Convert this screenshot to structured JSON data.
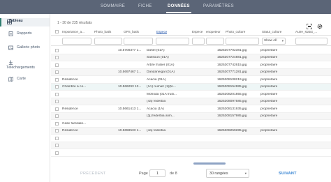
{
  "nav": {
    "tabs": [
      {
        "label": "SOMMAIRE"
      },
      {
        "label": "FICHE"
      },
      {
        "label": "DONNÉES"
      },
      {
        "label": "PARAMÈTRES"
      }
    ],
    "active_tab": "DONNÉES"
  },
  "sidebar": {
    "items": [
      {
        "label": "Tableau",
        "icon": "table-icon",
        "active": true
      },
      {
        "label": "Rapports",
        "icon": "report-icon",
        "active": false
      },
      {
        "label": "Gallerie photo",
        "icon": "photo-gallery-icon",
        "active": false
      },
      {
        "label": "Téléchargements",
        "icon": "download-icon",
        "active": false
      },
      {
        "label": "Carte",
        "icon": "map-icon",
        "active": false
      }
    ]
  },
  "table": {
    "results_text": "1 - 30 de 235 résultats",
    "columns": [
      {
        "label": "Importance_a..."
      },
      {
        "label": "Photo_batis"
      },
      {
        "label": "GPS_batis"
      },
      {
        "label": "Espece"
      },
      {
        "label": "Espece"
      },
      {
        "label": "enqueteur"
      },
      {
        "label": "Photo_culture"
      },
      {
        "label": "Statut_culture"
      },
      {
        "label": "Autre_statut_..."
      }
    ],
    "filter_select_value": "Show All",
    "rows": [
      {
        "importance": "",
        "gps": "10.5700377 1...",
        "espece": "Dahel (01A)",
        "photo": "1625307702381.jpg",
        "statut": "propriétaire"
      },
      {
        "importance": "",
        "gps": "",
        "espece": "Sassoun (01A)",
        "photo": "1625307724881.jpg",
        "statut": "propriétaire"
      },
      {
        "importance": "",
        "gps": "",
        "espece": "Arbre fruitier (01A)",
        "photo": "1625307742615.jpg",
        "statut": "propriétaire"
      },
      {
        "importance": "",
        "gps": "10.5697467 1...",
        "espece": "Dandaneigal (01A)",
        "photo": "1625307771281.jpg",
        "statut": "propriétaire"
      },
      {
        "importance": "Résidence",
        "gps": "",
        "espece": "Acacia (01A)",
        "photo": "1625308108219.jpg",
        "statut": "propriétaire"
      },
      {
        "importance": "Chambre à co...",
        "gps": "10.566293 13...",
        "espece": "(1A) numier (1)(fe...",
        "photo": "1625308154985.jpg",
        "statut": "propriétaire"
      },
      {
        "importance": "",
        "gps": "",
        "espece": "Mohoda (01A fruiti...",
        "photo": "1625308201855.jpg",
        "statut": "propriétaire"
      },
      {
        "importance": "",
        "gps": "",
        "espece": "(4a) federbia",
        "photo": "1625308097585.jpg",
        "statut": "propriétaire"
      },
      {
        "importance": "Résidence",
        "gps": "10.5661413 1...",
        "espece": "Acacia (1A)",
        "photo": "1625308131935.jpg",
        "statut": "propriétaire"
      },
      {
        "importance": "",
        "gps": "",
        "espece": "(2j) federbia alim...",
        "photo": "1625308157985.jpg",
        "statut": "propriétaire"
      },
      {
        "importance": "Case familiale...",
        "gps": "",
        "espece": "",
        "photo": "",
        "statut": ""
      },
      {
        "importance": "Résidence",
        "gps": "10.5659533 1...",
        "espece": "(4a) federbia",
        "photo": "1625308259285.jpg",
        "statut": "propriétaire"
      }
    ]
  },
  "pager": {
    "prev_label": "PRÉCÉDENT",
    "page_label": "Page",
    "page_value": "1",
    "of_label": "de 8",
    "rows_select": "30 rangées",
    "next_label": "SUIVANT"
  },
  "colors": {
    "nav_bg": "#5b6577",
    "accent": "#2f7fd1",
    "sidebar_active": "#2e7d6f"
  }
}
